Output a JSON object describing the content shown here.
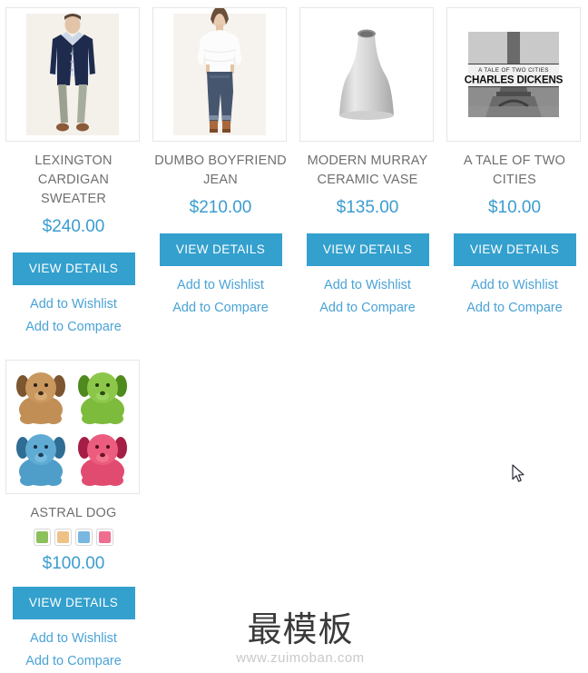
{
  "theme": {
    "accent_blue": "#33a0ce",
    "link_blue": "#4aa3d6",
    "price_blue": "#3b9cd0",
    "title_gray": "#6f6f6f",
    "border_gray": "#e6e6e6"
  },
  "labels": {
    "view_details": "VIEW DETAILS",
    "add_to_wishlist": "Add to Wishlist",
    "add_to_compare": "Add to Compare"
  },
  "products": [
    {
      "name": "LEXINGTON CARDIGAN SWEATER",
      "price": "$240.00",
      "image": "man-in-navy-cardigan-photo",
      "swatches": []
    },
    {
      "name": "DUMBO BOYFRIEND JEAN",
      "price": "$210.00",
      "image": "woman-in-white-top-and-jeans-photo",
      "swatches": []
    },
    {
      "name": "MODERN MURRAY CERAMIC VASE",
      "price": "$135.00",
      "image": "gray-ceramic-vase-photo",
      "swatches": []
    },
    {
      "name": "A TALE OF TWO CITIES",
      "price": "$10.00",
      "image": "book-cover-eiffel-tower-photo",
      "book_cover": {
        "title": "A TALE OF TWO CITIES",
        "author": "CHARLES DICKENS"
      },
      "swatches": []
    },
    {
      "name": "ASTRAL DOG",
      "price": "$100.00",
      "image": "four-plush-dogs-photo",
      "swatches": [
        {
          "name": "green",
          "color": "#8cc05a"
        },
        {
          "name": "tan",
          "color": "#eec286"
        },
        {
          "name": "blue",
          "color": "#79b6e0"
        },
        {
          "name": "pink",
          "color": "#ef6e90"
        }
      ]
    }
  ],
  "watermark": {
    "text": "最模板",
    "url": "www.zuimoban.com"
  }
}
